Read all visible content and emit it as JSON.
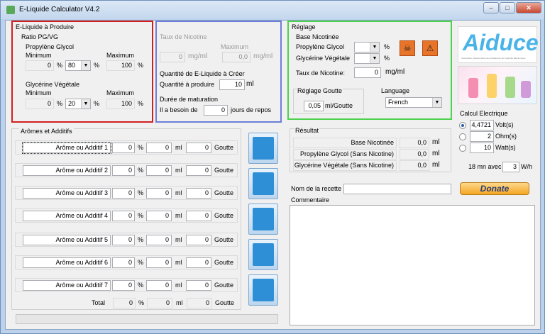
{
  "window": {
    "title": "E-Liquide Calculator V4.2",
    "btn_min": "–",
    "btn_max": "□",
    "btn_close": "✕"
  },
  "produce": {
    "title": "E-Liquide à Produire",
    "ratio": "Ratio PG/VG",
    "pg_title": "Propylène Glycol",
    "min": "Minimum",
    "max": "Maximum",
    "pg_min": "0",
    "pg_sel": "80",
    "pg_max": "100",
    "vg_title": "Glycérine Végétale",
    "vg_min": "0",
    "vg_sel": "20",
    "vg_max": "100",
    "pct": "%"
  },
  "nicotine": {
    "title": "Taux de Nicotine",
    "max": "Maximum",
    "val": "0",
    "unit": "mg/ml",
    "max_val": "0,0",
    "qty_title": "Quantité de E-Liquide à Créer",
    "qty_label": "Quantité à produire",
    "qty_val": "10",
    "qty_unit": "ml",
    "dur_title": "Durée de maturation",
    "dur_label": "Il a besoin de",
    "dur_val": "0",
    "dur_unit": "jours de repos"
  },
  "reglage": {
    "title": "Réglage",
    "base_title": "Base Nicotinée",
    "pg": "Propylène Glycol",
    "vg": "Glycérine Végétale",
    "pct": "%",
    "rate_label": "Taux de Nicotine:",
    "rate_val": "0",
    "rate_unit": "mg/ml",
    "drop_title": "Réglage Goutte",
    "drop_val": "0,05",
    "drop_unit": "ml/Goutte",
    "lang_title": "Language",
    "lang_val": "French"
  },
  "logo": {
    "text": "Aiduce",
    "subtext": "Association Indépendante des Utilisateurs de Cigarette Électronique"
  },
  "electric": {
    "title": "Calcul Electrique",
    "volt_val": "4,4721",
    "volt_unit": "Volt(s)",
    "ohm_val": "2",
    "ohm_unit": "Ohm(s)",
    "watt_val": "10",
    "watt_unit": "Watt(s)",
    "time_val": "18 mn avec",
    "wh_val": "3",
    "wh_unit": "W/h"
  },
  "aromes": {
    "title": "Arômes et Additifs",
    "items": [
      {
        "label": "Arôme ou Additif 1",
        "pct": "0",
        "ml": "0",
        "drops": "0"
      },
      {
        "label": "Arôme ou Additif 2",
        "pct": "0",
        "ml": "0",
        "drops": "0"
      },
      {
        "label": "Arôme ou Additif 3",
        "pct": "0",
        "ml": "0",
        "drops": "0"
      },
      {
        "label": "Arôme ou Additif 4",
        "pct": "0",
        "ml": "0",
        "drops": "0"
      },
      {
        "label": "Arôme ou Additif 5",
        "pct": "0",
        "ml": "0",
        "drops": "0"
      },
      {
        "label": "Arôme ou Additif 6",
        "pct": "0",
        "ml": "0",
        "drops": "0"
      },
      {
        "label": "Arôme ou Additif 7",
        "pct": "0",
        "ml": "0",
        "drops": "0"
      }
    ],
    "total_label": "Total",
    "total_pct": "0",
    "total_ml": "0",
    "total_drops": "0",
    "pct": "%",
    "ml": "ml",
    "goutte": "Goutte"
  },
  "result": {
    "title": "Résultat",
    "rows": [
      {
        "label": "Base Nicotinée",
        "val": "0,0",
        "unit": "ml"
      },
      {
        "label": "Propylène Glycol (Sans Nicotine)",
        "val": "0,0",
        "unit": "ml"
      },
      {
        "label": "Glycérine Végétale (Sans Nicotine)",
        "val": "0,0",
        "unit": "ml"
      }
    ]
  },
  "recipe": {
    "name_label": "Nom de la recette :",
    "comment_label": "Commentaire",
    "donate": "Donate"
  },
  "colors": {
    "red": "#d02020",
    "blue": "#6b7fd8",
    "green": "#4cd24c",
    "orange": "#f5a623"
  }
}
